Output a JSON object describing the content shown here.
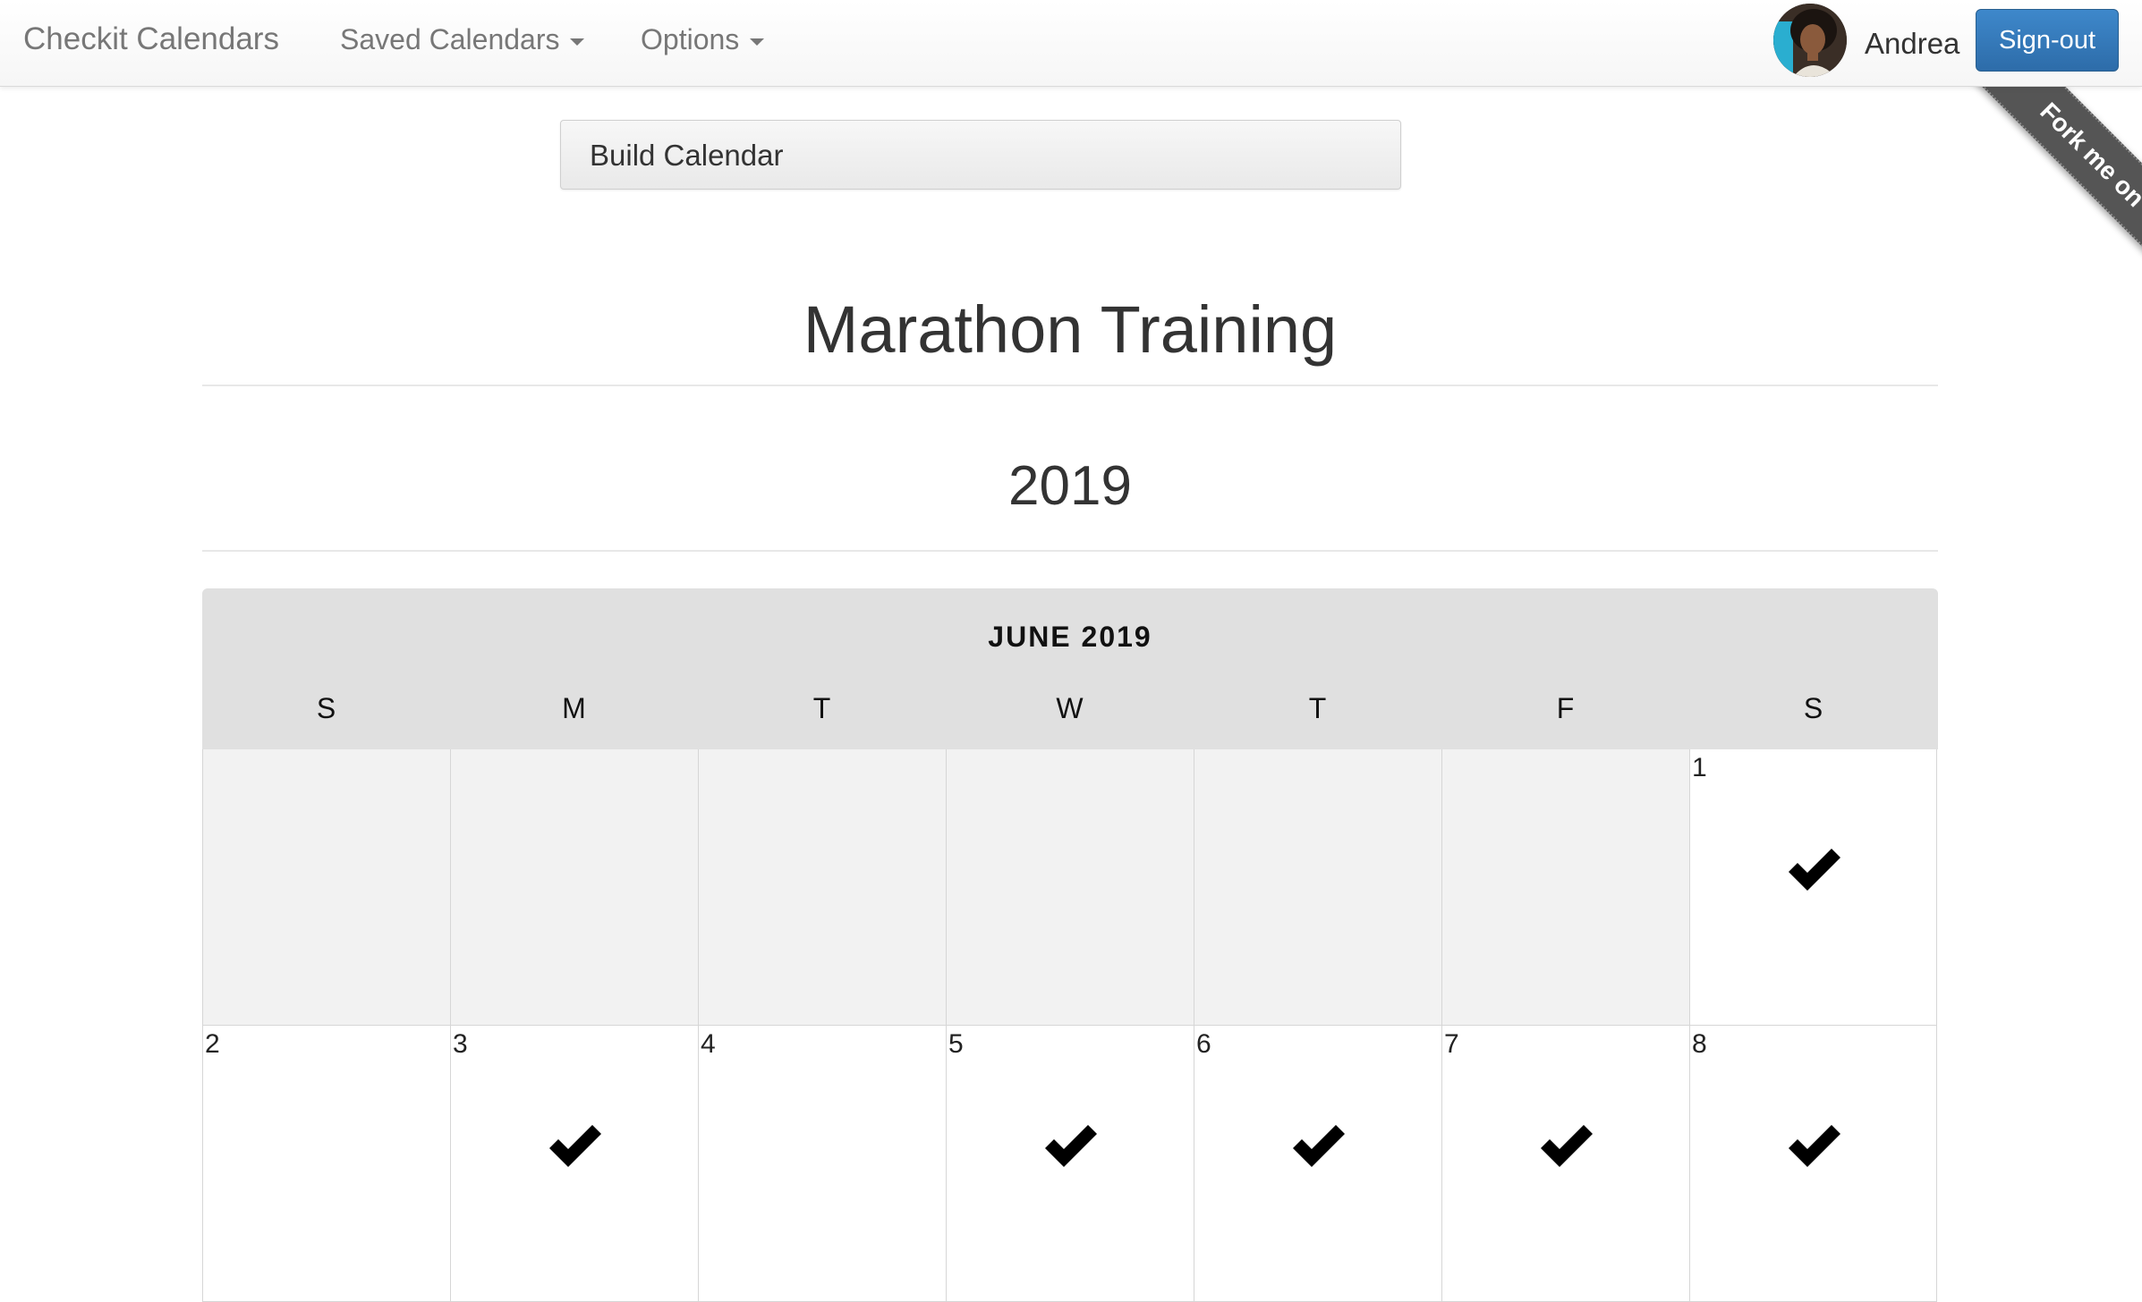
{
  "navbar": {
    "brand": "Checkit Calendars",
    "saved_calendars": "Saved Calendars",
    "options": "Options",
    "user_name": "Andrea",
    "signout": "Sign-out"
  },
  "ribbon": {
    "text": "Fork me on GitHub"
  },
  "build_button": "Build Calendar",
  "calendar": {
    "title": "Marathon Training",
    "year": "2019",
    "month_label": "JUNE 2019",
    "weekdays": [
      "S",
      "M",
      "T",
      "W",
      "T",
      "F",
      "S"
    ],
    "weeks": [
      [
        {
          "day": "",
          "checked": false
        },
        {
          "day": "",
          "checked": false
        },
        {
          "day": "",
          "checked": false
        },
        {
          "day": "",
          "checked": false
        },
        {
          "day": "",
          "checked": false
        },
        {
          "day": "",
          "checked": false
        },
        {
          "day": "1",
          "checked": true
        }
      ],
      [
        {
          "day": "2",
          "checked": false
        },
        {
          "day": "3",
          "checked": true
        },
        {
          "day": "4",
          "checked": false
        },
        {
          "day": "5",
          "checked": true
        },
        {
          "day": "6",
          "checked": true
        },
        {
          "day": "7",
          "checked": true
        },
        {
          "day": "8",
          "checked": true
        }
      ]
    ]
  },
  "colors": {
    "primary_button": "#337ab7",
    "header_bg": "#e0e0e0",
    "empty_cell_bg": "#f2f2f2"
  },
  "icons": {
    "caret": "caret-down-icon",
    "check": "checkmark-icon"
  }
}
